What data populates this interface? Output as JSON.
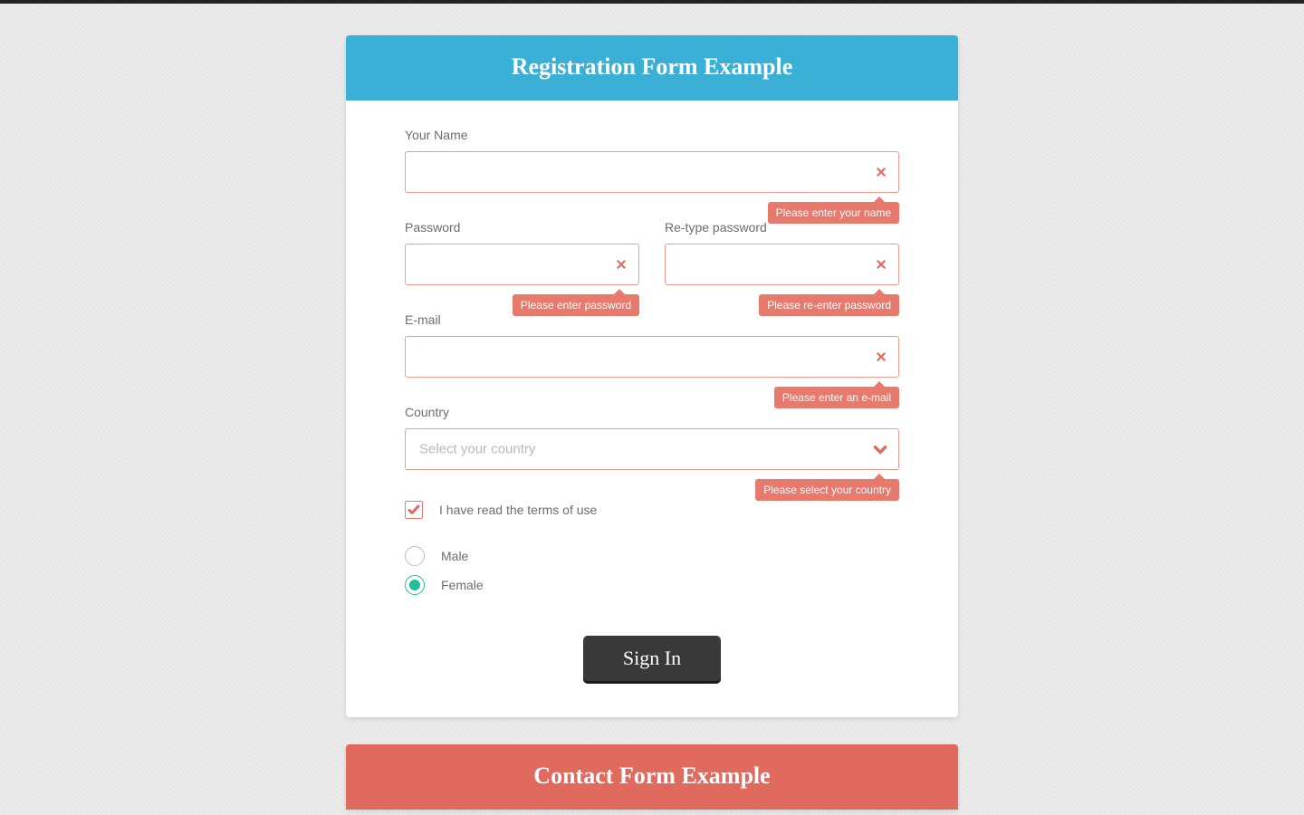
{
  "colors": {
    "header_blue": "#3bb0d6",
    "header_red": "#e06a5e",
    "error": "#e7796d",
    "teal": "#1fbf9b"
  },
  "registration": {
    "title": "Registration Form Example",
    "name": {
      "label": "Your Name",
      "value": "",
      "error": "Please enter your name"
    },
    "password": {
      "label": "Password",
      "value": "",
      "error": "Please enter password"
    },
    "repassword": {
      "label": "Re-type password",
      "value": "",
      "error": "Please re-enter password"
    },
    "email": {
      "label": "E-mail",
      "value": "",
      "error": "Please enter an e-mail"
    },
    "country": {
      "label": "Country",
      "placeholder": "Select your country",
      "error": "Please select your country"
    },
    "terms": {
      "label": "I have read the terms of use",
      "checked": true
    },
    "gender": {
      "options": [
        {
          "label": "Male",
          "selected": false
        },
        {
          "label": "Female",
          "selected": true
        }
      ]
    },
    "submit_label": "Sign In"
  },
  "contact": {
    "title": "Contact Form Example"
  }
}
